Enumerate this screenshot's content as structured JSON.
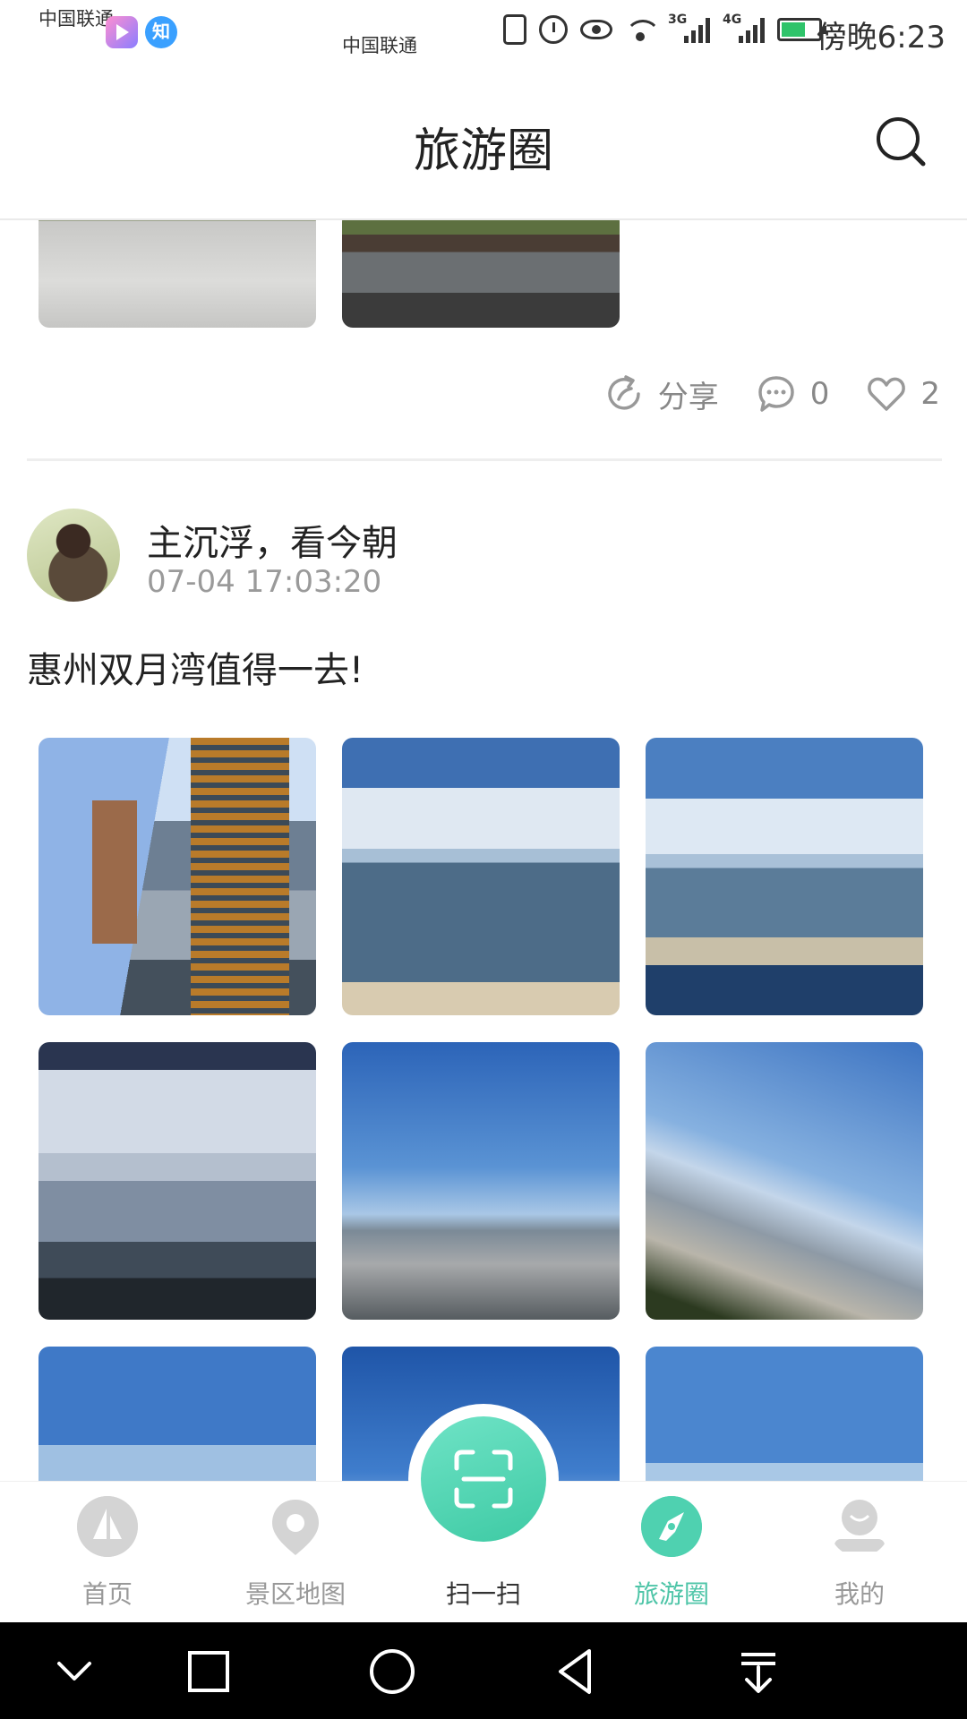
{
  "status_bar": {
    "carrier_1": "中国联通",
    "carrier_2": "中国联通",
    "app_badge_2": "知",
    "network_3g": "3G",
    "network_4g": "4G",
    "time": "傍晚6:23",
    "battery_level": 0.6
  },
  "header": {
    "title": "旅游圈"
  },
  "previous_post": {
    "actions": {
      "share_label": "分享",
      "comment_count": "0",
      "like_count": "2"
    }
  },
  "post": {
    "author": "主沉浮，看今朝",
    "time": "07-04 17:03:20",
    "text": "惠州双月湾值得一去!"
  },
  "bottom_nav": {
    "items": [
      {
        "label": "首页",
        "icon": "home-sail-icon"
      },
      {
        "label": "景区地图",
        "icon": "map-pin-icon"
      },
      {
        "label": "扫一扫",
        "icon": "scan-icon"
      },
      {
        "label": "旅游圈",
        "icon": "compass-icon"
      },
      {
        "label": "我的",
        "icon": "profile-icon"
      }
    ],
    "active_index": 3
  },
  "colors": {
    "accent": "#4fc5a8",
    "inactive": "#999999"
  }
}
